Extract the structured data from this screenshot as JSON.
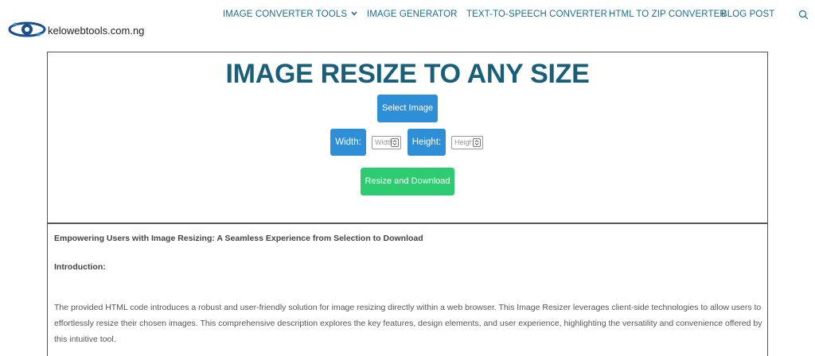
{
  "header": {
    "site_name": "kelowebtools.com.ng",
    "nav": [
      {
        "label": "IMAGE CONVERTER TOOLS"
      },
      {
        "label": "IMAGE GENERATOR"
      },
      {
        "label": "TEXT-TO-SPEECH CONVERTER"
      },
      {
        "label": "HTML TO ZIP CONVERTER"
      },
      {
        "label": "BLOG POST"
      }
    ]
  },
  "tool": {
    "title": "IMAGE RESIZE TO ANY SIZE",
    "select_button": "Select Image",
    "width_label": "Width:",
    "width_placeholder": "Width",
    "height_label": "Height:",
    "height_placeholder": "Height",
    "resize_button": "Resize and Download"
  },
  "description": {
    "heading": "Empowering Users with Image Resizing: A Seamless Experience from Selection to Download",
    "intro_label": "Introduction:",
    "paragraph": "The provided HTML code introduces a robust and user-friendly solution for image resizing directly within a web browser. This Image Resizer leverages client-side technologies to allow users to effortlessly resize their chosen images. This comprehensive description explores the key features, design elements, and user experience, highlighting the versatility and convenience offered by this intuitive tool."
  },
  "colors": {
    "nav_text": "#1b6e8c",
    "title": "#1a5f7a",
    "button_blue": "#2e8fd6",
    "button_green": "#2ecc71"
  },
  "icons": [
    "logo-icon",
    "chevron-down-icon",
    "search-icon",
    "spinner-arrows-icon"
  ]
}
